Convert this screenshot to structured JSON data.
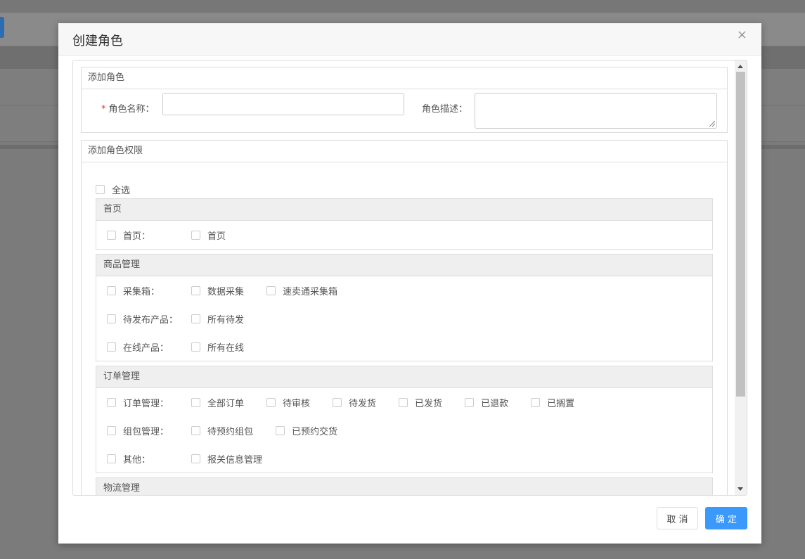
{
  "modal": {
    "title": "创建角色",
    "close_glyph": "×",
    "role_panel": {
      "title": "添加角色",
      "required_mark": "*",
      "name_label": "角色名称：",
      "name_value": "",
      "desc_label": "角色描述：",
      "desc_value": ""
    },
    "perm_panel": {
      "title": "添加角色权限",
      "select_all": "全选",
      "groups": [
        {
          "title": "首页",
          "rows": [
            {
              "lead": "首页：",
              "options": [
                "首页"
              ]
            }
          ]
        },
        {
          "title": "商品管理",
          "rows": [
            {
              "lead": "采集箱：",
              "options": [
                "数据采集",
                "速卖通采集箱"
              ]
            },
            {
              "lead": "待发布产品：",
              "options": [
                "所有待发"
              ]
            },
            {
              "lead": "在线产品：",
              "options": [
                "所有在线"
              ]
            }
          ]
        },
        {
          "title": "订单管理",
          "rows": [
            {
              "lead": "订单管理：",
              "options": [
                "全部订单",
                "待审核",
                "待发货",
                "已发货",
                "已退款",
                "已搁置"
              ]
            },
            {
              "lead": "组包管理：",
              "options": [
                "待预约组包",
                "已预约交货"
              ]
            },
            {
              "lead": "其他：",
              "options": [
                "报关信息管理"
              ]
            }
          ]
        },
        {
          "title": "物流管理",
          "rows": []
        }
      ]
    },
    "footer": {
      "cancel": "取 消",
      "ok": "确 定"
    }
  },
  "colors": {
    "primary": "#3b99fc",
    "required": "#e4393c",
    "overlay": "#7b7b7b"
  }
}
